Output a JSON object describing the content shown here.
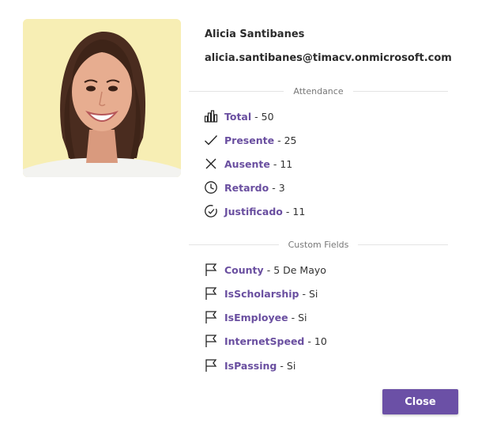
{
  "profile": {
    "name": "Alicia Santibanes",
    "email": "alicia.santibanes@timacv.onmicrosoft.com"
  },
  "attendance": {
    "heading": "Attendance",
    "items": [
      {
        "icon": "bar-chart-icon",
        "label": "Total",
        "sep": "-",
        "value": "50"
      },
      {
        "icon": "checkmark-icon",
        "label": "Presente",
        "sep": "-",
        "value": "25"
      },
      {
        "icon": "x-icon",
        "label": "Ausente",
        "sep": "-",
        "value": "11"
      },
      {
        "icon": "clock-icon",
        "label": "Retardo",
        "sep": "-",
        "value": "3"
      },
      {
        "icon": "clock-check-icon",
        "label": "Justificado",
        "sep": "-",
        "value": "11"
      }
    ]
  },
  "custom_fields": {
    "heading": "Custom Fields",
    "items": [
      {
        "icon": "flag-icon",
        "label": "County",
        "sep": "-",
        "value": "5 De Mayo"
      },
      {
        "icon": "flag-icon",
        "label": "IsScholarship",
        "sep": "-",
        "value": "Si"
      },
      {
        "icon": "flag-icon",
        "label": "IsEmployee",
        "sep": "-",
        "value": "Si"
      },
      {
        "icon": "flag-icon",
        "label": "InternetSpeed",
        "sep": "-",
        "value": "10"
      },
      {
        "icon": "flag-icon",
        "label": "IsPassing",
        "sep": "-",
        "value": "Si"
      }
    ]
  },
  "actions": {
    "close_label": "Close"
  },
  "colors": {
    "accent": "#6b50a6",
    "label": "#6a4fa0",
    "photo_bg": "#f7eeb4"
  }
}
